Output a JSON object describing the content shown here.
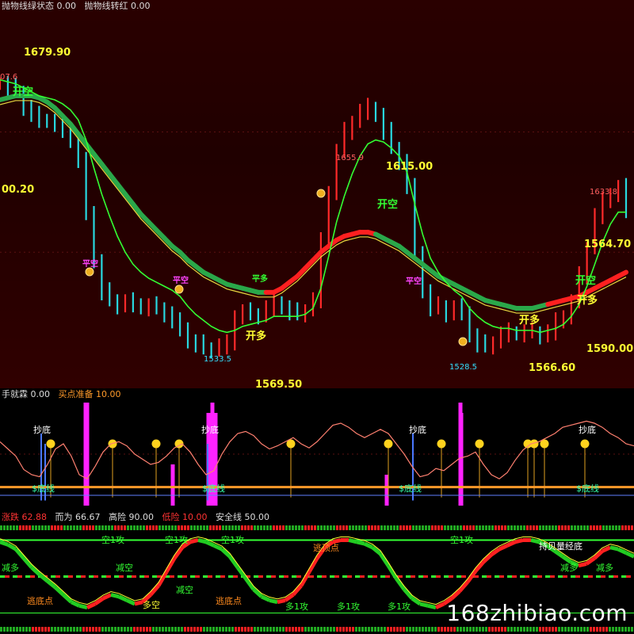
{
  "main_header": {
    "label_a": "抛物线绿状态",
    "value_a": "0.00",
    "label_b": "抛物线转红",
    "value_b": "0.00"
  },
  "osc_header": {
    "label_a": "手就霖",
    "value_a": "0.00",
    "label_b": "买点准备",
    "value_b": "10.00"
  },
  "trend_header": {
    "label_a": "涨跌",
    "value_a": "62.88",
    "label_b": "而为",
    "value_b": "66.67",
    "label_c": "高险",
    "value_c": "90.00",
    "label_d": "低险",
    "value_d": "10.00",
    "label_e": "安全线",
    "value_e": "50.00"
  },
  "watermark": "168zhibiao.com",
  "chart_data": [
    {
      "type": "line",
      "title": "",
      "price_labels": [
        {
          "text": "1679.90",
          "color": "#ffff33"
        },
        {
          "text": "07.6",
          "color": "#ff6060"
        },
        {
          "text": "00.20",
          "color": "#ffff33"
        },
        {
          "text": "1655.9",
          "color": "#ff6060"
        },
        {
          "text": "1615.00",
          "color": "#ffff33"
        },
        {
          "text": "1633.8",
          "color": "#ff6060"
        },
        {
          "text": "1564.70",
          "color": "#ffff33"
        },
        {
          "text": "1533.5",
          "color": "#33e0ff"
        },
        {
          "text": "1528.5",
          "color": "#33e0ff"
        },
        {
          "text": "1569.50",
          "color": "#ffff33"
        },
        {
          "text": "1566.60",
          "color": "#ffff33"
        },
        {
          "text": "1590.00",
          "color": "#ffff33"
        }
      ],
      "signals": [
        {
          "text": "开空",
          "color": "#33ff33"
        },
        {
          "text": "开空",
          "color": "#33ff33"
        },
        {
          "text": "开空",
          "color": "#33ff33"
        },
        {
          "text": "开多",
          "color": "#ffff33"
        },
        {
          "text": "开多",
          "color": "#ffff33"
        },
        {
          "text": "开多",
          "color": "#ffff33"
        },
        {
          "text": "平空",
          "color": "#ff44ff"
        },
        {
          "text": "平空",
          "color": "#ff44ff"
        },
        {
          "text": "平空",
          "color": "#ff44ff"
        },
        {
          "text": "平多",
          "color": "#33ff33"
        }
      ],
      "close": [
        1664,
        1662,
        1660,
        1652,
        1648,
        1646,
        1645,
        1644,
        1640,
        1636,
        1625,
        1600,
        1575,
        1560,
        1556,
        1553,
        1555,
        1554,
        1552,
        1553,
        1552,
        1549,
        1545,
        1542,
        1535,
        1534,
        1532,
        1531,
        1533,
        1534,
        1548,
        1550,
        1549,
        1548,
        1552,
        1555,
        1552,
        1550,
        1549,
        1551,
        1556,
        1585,
        1610,
        1630,
        1640,
        1645,
        1650,
        1652,
        1648,
        1640,
        1632,
        1625,
        1612,
        1580,
        1560,
        1552,
        1553,
        1549,
        1552,
        1550,
        1538,
        1534,
        1533,
        1535,
        1539,
        1540,
        1539,
        1540,
        1540,
        1538,
        1540,
        1545,
        1548,
        1555,
        1568,
        1582,
        1598,
        1605,
        1609,
        1612,
        1600
      ],
      "ma_fast": [
        1666,
        1665,
        1664,
        1662,
        1660,
        1658,
        1657,
        1656,
        1654,
        1651,
        1646,
        1636,
        1622,
        1609,
        1598,
        1588,
        1580,
        1574,
        1570,
        1567,
        1565,
        1563,
        1561,
        1558,
        1553,
        1549,
        1546,
        1543,
        1541,
        1540,
        1541,
        1543,
        1544,
        1545,
        1546,
        1548,
        1548,
        1548,
        1548,
        1549,
        1552,
        1562,
        1578,
        1595,
        1608,
        1619,
        1628,
        1634,
        1636,
        1635,
        1632,
        1628,
        1620,
        1604,
        1589,
        1577,
        1570,
        1565,
        1561,
        1558,
        1552,
        1548,
        1545,
        1543,
        1542,
        1542,
        1541,
        1541,
        1541,
        1540,
        1541,
        1542,
        1544,
        1548,
        1554,
        1563,
        1574,
        1585,
        1594,
        1600,
        1600
      ],
      "sar": [
        1656,
        1657,
        1658,
        1658,
        1658,
        1657,
        1655,
        1652,
        1648,
        1644,
        1639,
        1634,
        1629,
        1624,
        1619,
        1614,
        1609,
        1604,
        1599,
        1595,
        1591,
        1587,
        1583,
        1580,
        1576,
        1573,
        1570,
        1568,
        1566,
        1564,
        1563,
        1562,
        1561,
        1560,
        1560,
        1560,
        1562,
        1565,
        1568,
        1572,
        1576,
        1580,
        1583,
        1586,
        1588,
        1589,
        1590,
        1590,
        1589,
        1587,
        1585,
        1583,
        1580,
        1577,
        1574,
        1571,
        1568,
        1566,
        1564,
        1562,
        1560,
        1558,
        1556,
        1555,
        1554,
        1553,
        1552,
        1552,
        1552,
        1553,
        1554,
        1555,
        1556,
        1557,
        1558,
        1560,
        1562,
        1564,
        1566,
        1568,
        1570
      ],
      "sar_bull": [
        false,
        false,
        false,
        false,
        false,
        false,
        false,
        false,
        false,
        false,
        false,
        false,
        false,
        false,
        false,
        false,
        false,
        false,
        false,
        false,
        false,
        false,
        false,
        false,
        false,
        false,
        false,
        false,
        false,
        false,
        false,
        false,
        false,
        false,
        true,
        true,
        true,
        true,
        true,
        true,
        true,
        true,
        true,
        true,
        true,
        true,
        true,
        true,
        false,
        false,
        false,
        false,
        false,
        false,
        false,
        false,
        false,
        false,
        false,
        false,
        false,
        false,
        false,
        false,
        false,
        false,
        false,
        false,
        false,
        false,
        true,
        true,
        true,
        true,
        true,
        true,
        true,
        true,
        true,
        true,
        true
      ]
    },
    {
      "type": "line",
      "title": "",
      "labels": [
        {
          "text": "抄底",
          "color": "#ffffff"
        },
        {
          "text": "抄底",
          "color": "#ffffff"
        },
        {
          "text": "抄底",
          "color": "#ffffff"
        },
        {
          "text": "抄底",
          "color": "#ffffff"
        },
        {
          "text": "$底线",
          "color": "#33ffaa"
        },
        {
          "text": "$底线",
          "color": "#33ffaa"
        },
        {
          "text": "$底线",
          "color": "#33ffaa"
        },
        {
          "text": "$底线",
          "color": "#33ffaa"
        }
      ],
      "oscillator": [
        62,
        55,
        48,
        35,
        30,
        28,
        40,
        55,
        60,
        48,
        30,
        26,
        38,
        52,
        60,
        62,
        58,
        50,
        45,
        40,
        42,
        48,
        56,
        60,
        52,
        40,
        30,
        34,
        50,
        62,
        70,
        72,
        68,
        60,
        55,
        58,
        62,
        66,
        60,
        56,
        62,
        70,
        78,
        80,
        76,
        70,
        66,
        70,
        74,
        70,
        60,
        50,
        38,
        28,
        30,
        36,
        34,
        40,
        46,
        48,
        52,
        40,
        30,
        26,
        32,
        44,
        54,
        60,
        62,
        66,
        70,
        76,
        78,
        80,
        82,
        80,
        76,
        70,
        66,
        60,
        58
      ],
      "bottom_line": 10,
      "prepare_line": 18
    },
    {
      "type": "area",
      "title": "",
      "labels": [
        {
          "text": "空1攻",
          "color": "#33ff33"
        },
        {
          "text": "空1攻",
          "color": "#33ff33"
        },
        {
          "text": "空1攻",
          "color": "#33ff33"
        },
        {
          "text": "空1攻",
          "color": "#33ff33"
        },
        {
          "text": "减多",
          "color": "#33ff33"
        },
        {
          "text": "减多",
          "color": "#33ff33"
        },
        {
          "text": "减多",
          "color": "#33ff33"
        },
        {
          "text": "减空",
          "color": "#33ff33"
        },
        {
          "text": "减空",
          "color": "#33ff33"
        },
        {
          "text": "多1攻",
          "color": "#33ff33"
        },
        {
          "text": "多1攻",
          "color": "#33ff33"
        },
        {
          "text": "多1攻",
          "color": "#33ff33"
        },
        {
          "text": "逃底点",
          "color": "#ff8a1e"
        },
        {
          "text": "逃底点",
          "color": "#ff8a1e"
        },
        {
          "text": "逃顶点",
          "color": "#ff8a1e"
        },
        {
          "text": "多空",
          "color": "#ffff33"
        },
        {
          "text": "持贝量经底",
          "color": "#ffffff"
        }
      ],
      "trend": [
        88,
        85,
        80,
        70,
        60,
        52,
        45,
        38,
        30,
        22,
        18,
        16,
        20,
        26,
        30,
        28,
        24,
        20,
        22,
        30,
        40,
        55,
        70,
        82,
        88,
        90,
        88,
        84,
        80,
        72,
        60,
        48,
        36,
        28,
        24,
        22,
        24,
        30,
        40,
        55,
        70,
        82,
        88,
        90,
        90,
        88,
        86,
        82,
        75,
        62,
        48,
        36,
        26,
        20,
        18,
        16,
        20,
        26,
        34,
        44,
        56,
        66,
        74,
        80,
        84,
        88,
        90,
        90,
        88,
        84,
        78,
        72,
        66,
        62,
        64,
        70,
        78,
        82,
        80,
        76,
        72
      ],
      "high_line": 90,
      "low_line": 10,
      "safe_line": 50
    }
  ]
}
